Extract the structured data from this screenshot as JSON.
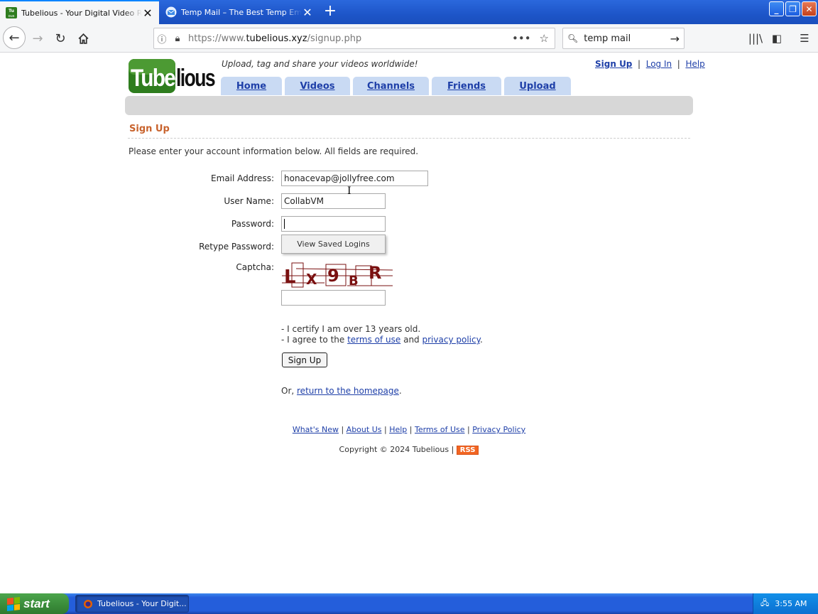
{
  "browser": {
    "tabs": [
      {
        "title": "Tubelious - Your Digital Video Repository",
        "active": true
      },
      {
        "title": "Temp Mail – The Best Temp Email Service",
        "active": false
      }
    ],
    "new_tab_icon": "plus-icon",
    "url_prefix": "https://www.",
    "url_host": "tubelious.xyz",
    "url_path": "/signup.php",
    "search_value": "temp mail"
  },
  "site": {
    "logo_text": "Tubelious",
    "tagline": "Upload, tag and share your videos worldwide!",
    "top_links": [
      "Sign Up",
      "Log In",
      "Help"
    ],
    "nav_tabs": [
      "Home",
      "Videos",
      "Channels",
      "Friends",
      "Upload"
    ]
  },
  "signup": {
    "heading": "Sign Up",
    "intro": "Please enter your account information below. All fields are required.",
    "labels": {
      "email": "Email Address:",
      "username": "User Name:",
      "password": "Password:",
      "retype": "Retype Password:",
      "captcha": "Captcha:"
    },
    "values": {
      "email": "honacevap@jollyfree.com",
      "username": "CollabVM",
      "password": ""
    },
    "saved_logins_popup": "View Saved Logins",
    "captcha_text": "LX9BR",
    "cert_line1": "- I certify I am over 13 years old.",
    "cert_line2_prefix": "- I agree to the ",
    "terms_link": "terms of use",
    "cert_line2_and": " and ",
    "privacy_link": "privacy policy",
    "cert_line2_end": ".",
    "button": "Sign Up",
    "or_prefix": "Or, ",
    "home_link": "return to the homepage",
    "or_end": "."
  },
  "footer": {
    "links": [
      "What's New",
      "About Us",
      "Help",
      "Terms of Use",
      "Privacy Policy"
    ],
    "copyright": "Copyright © 2024 Tubelious",
    "rss": "RSS"
  },
  "taskbar": {
    "start": "start",
    "item": "Tubelious - Your Digit...",
    "clock": "3:55 AM"
  },
  "colors": {
    "accent_link": "#1e3fa8",
    "heading_orange": "#c8632d",
    "nav_tab_bg": "#c9daf3",
    "logo_green": "#2e7d1e",
    "captcha_red": "#7a1010"
  }
}
